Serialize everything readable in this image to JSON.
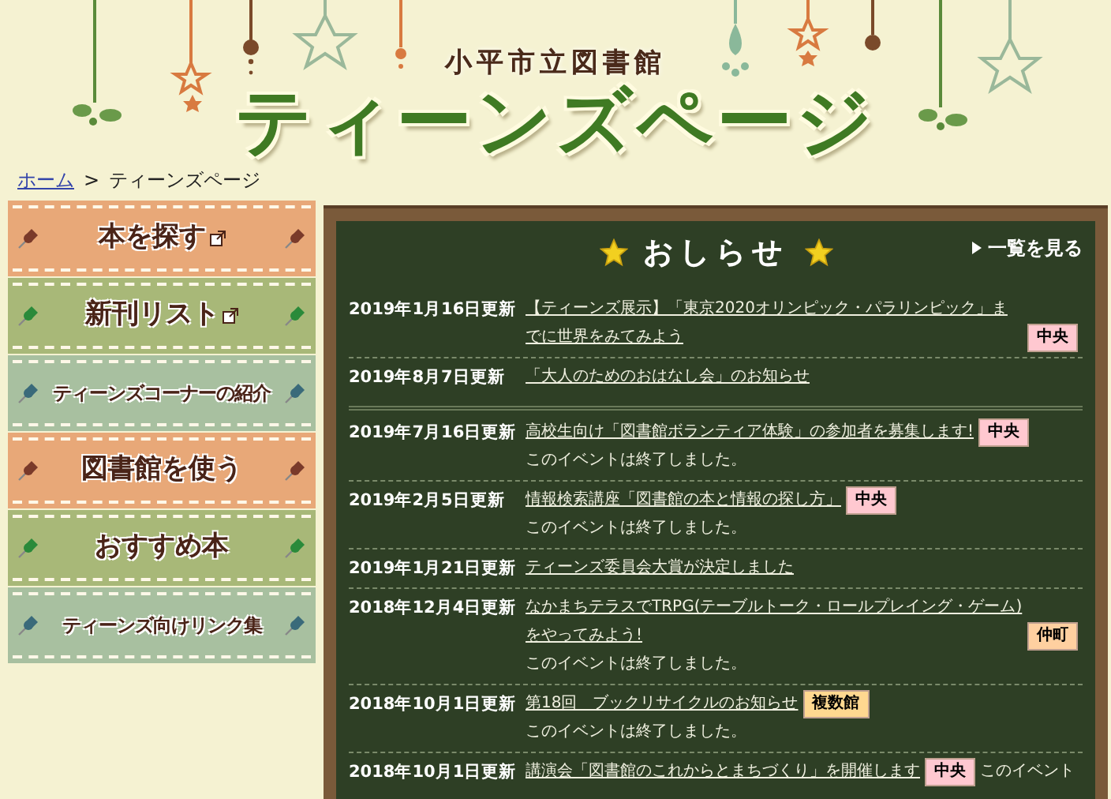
{
  "header": {
    "subtitle": "小平市立図書館",
    "title": "ティーンズページ"
  },
  "breadcrumb": {
    "home": "ホーム",
    "separator": ">",
    "current": "ティーンズページ"
  },
  "sidebar": {
    "items": [
      {
        "label": "本を探す",
        "color": "#e8a878",
        "external": true,
        "kind": "large"
      },
      {
        "label": "新刊リスト",
        "color": "#a8b878",
        "external": true,
        "kind": "large"
      },
      {
        "label": "ティーンズコーナーの紹介",
        "color": "#a8c0a0",
        "external": false,
        "kind": "small"
      },
      {
        "label": "図書館を使う",
        "color": "#e8a878",
        "external": false,
        "kind": "large"
      },
      {
        "label": "おすすめ本",
        "color": "#a8b878",
        "external": false,
        "kind": "large"
      },
      {
        "label": "ティーンズ向けリンク集",
        "color": "#a8c0a0",
        "external": false,
        "kind": "small"
      }
    ]
  },
  "news": {
    "title": "おしらせ",
    "more": "一覧を見る",
    "groups": [
      [
        {
          "date": "2019年1月16日更新",
          "link": "【ティーンズ展示】「東京2020オリンピック・パラリンピック」までに世界をみてみよう",
          "tag": {
            "label": "中央",
            "color": "#ffc8d0"
          }
        },
        {
          "date": "2019年8月7日更新",
          "link": "「大人のためのおはなし会」のお知らせ"
        }
      ],
      [
        {
          "date": "2019年7月16日更新",
          "link": "高校生向け「図書館ボランティア体験」の参加者を募集します!",
          "tag": {
            "label": "中央",
            "color": "#ffc8d0"
          },
          "note": "このイベントは終了しました。"
        },
        {
          "date": "2019年2月5日更新",
          "link": "情報検索講座「図書館の本と情報の探し方」",
          "tag": {
            "label": "中央",
            "color": "#ffc8d0"
          },
          "note": "このイベントは終了しました。"
        },
        {
          "date": "2019年1月21日更新",
          "link": "ティーンズ委員会大賞が決定しました"
        },
        {
          "date": "2018年12月4日更新",
          "link": "なかまちテラスでTRPG(テーブルトーク・ロールプレイング・ゲーム)をやってみよう!",
          "tag": {
            "label": "仲町",
            "color": "#ffd0a0"
          },
          "note": "このイベントは終了しました。"
        },
        {
          "date": "2018年10月1日更新",
          "link": "第18回　ブックリサイクルのお知らせ",
          "tag": {
            "label": "複数館",
            "color": "#ffd890"
          },
          "note": "このイベントは終了しました。"
        },
        {
          "date": "2018年10月1日更新",
          "link": "講演会「図書館のこれからとまちづくり」を開催します",
          "tag": {
            "label": "中央",
            "color": "#ffc8d0"
          },
          "note": "このイベント"
        }
      ]
    ]
  }
}
